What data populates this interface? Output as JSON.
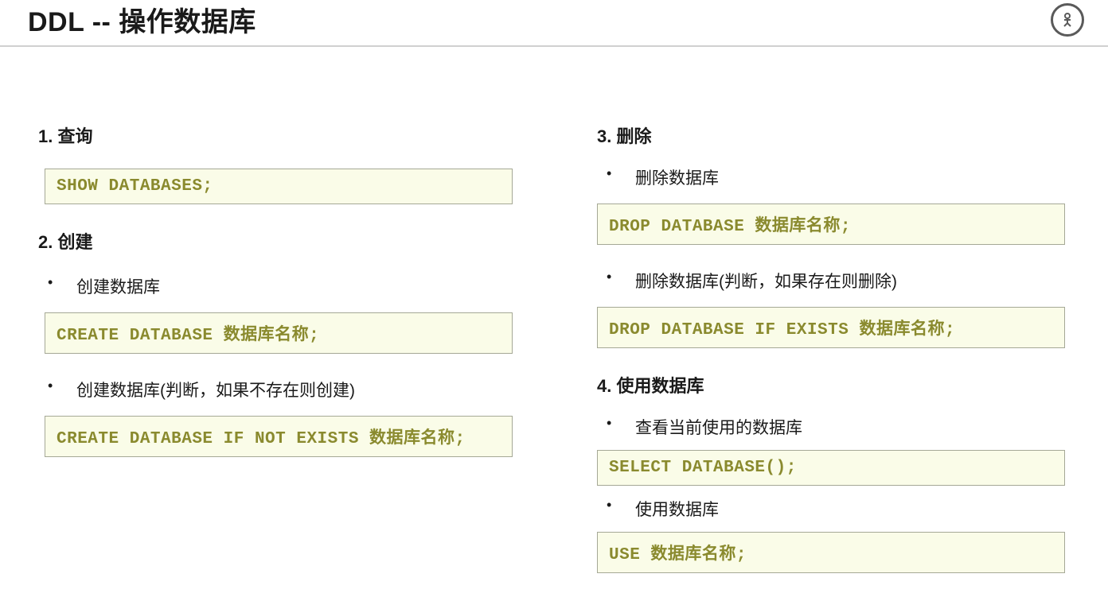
{
  "header": {
    "title": "DDL -- 操作数据库"
  },
  "left": {
    "section1": {
      "heading": "1. 查询",
      "code1": "SHOW DATABASES;"
    },
    "section2": {
      "heading": "2. 创建",
      "bullet1": "创建数据库",
      "code1": "CREATE DATABASE 数据库名称;",
      "bullet2": "创建数据库(判断，如果不存在则创建)",
      "code2": "CREATE DATABASE IF NOT EXISTS 数据库名称;"
    }
  },
  "right": {
    "section3": {
      "heading": "3. 删除",
      "bullet1": "删除数据库",
      "code1": "DROP DATABASE 数据库名称;",
      "bullet2": "删除数据库(判断，如果存在则删除)",
      "code2": "DROP DATABASE IF EXISTS 数据库名称;"
    },
    "section4": {
      "heading": "4. 使用数据库",
      "bullet1": "查看当前使用的数据库",
      "code1": "SELECT DATABASE();",
      "bullet2": "使用数据库",
      "code2": "USE 数据库名称;"
    }
  }
}
